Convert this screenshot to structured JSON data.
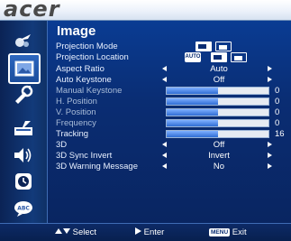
{
  "brand": {
    "logo_text": "acer"
  },
  "sidebar": {
    "items": [
      {
        "icon": "color-icon",
        "selected": false
      },
      {
        "icon": "image-icon",
        "selected": true
      },
      {
        "icon": "settings-icon",
        "selected": false
      },
      {
        "icon": "management-icon",
        "selected": false
      },
      {
        "icon": "audio-icon",
        "selected": false
      },
      {
        "icon": "timer-icon",
        "selected": false
      },
      {
        "icon": "language-icon",
        "selected": false
      }
    ]
  },
  "main": {
    "title": "Image",
    "rows": [
      {
        "label": "Projection Mode",
        "type": "icons",
        "options": [
          "front-projection-icon",
          "rear-projection-icon"
        ]
      },
      {
        "label": "Projection Location",
        "type": "icons",
        "auto_badge": "AUTO",
        "options": [
          "desktop-icon",
          "ceiling-icon"
        ]
      },
      {
        "label": "Aspect Ratio",
        "type": "select",
        "value": "Auto"
      },
      {
        "label": "Auto Keystone",
        "type": "select",
        "value": "Off"
      },
      {
        "label": "Manual Keystone",
        "type": "slider",
        "value": "0",
        "level": 0.5,
        "disabled": true
      },
      {
        "label": "H. Position",
        "type": "slider",
        "value": "0",
        "level": 0.5,
        "disabled": true
      },
      {
        "label": "V. Position",
        "type": "slider",
        "value": "0",
        "level": 0.5,
        "disabled": true
      },
      {
        "label": "Frequency",
        "type": "slider",
        "value": "0",
        "level": 0.5,
        "disabled": true
      },
      {
        "label": "Tracking",
        "type": "slider",
        "value": "16",
        "level": 0.5,
        "disabled": false
      },
      {
        "label": "3D",
        "type": "select",
        "value": "Off"
      },
      {
        "label": "3D Sync Invert",
        "type": "select",
        "value": "Invert"
      },
      {
        "label": "3D Warning Message",
        "type": "select",
        "value": "No"
      }
    ]
  },
  "footer": {
    "select_label": "Select",
    "enter_label": "Enter",
    "menu_key": "MENU",
    "exit_label": "Exit"
  },
  "colors": {
    "background": "#0a2a5e",
    "highlight": "#ffffff",
    "slider_fill": "#2f6dd4"
  }
}
